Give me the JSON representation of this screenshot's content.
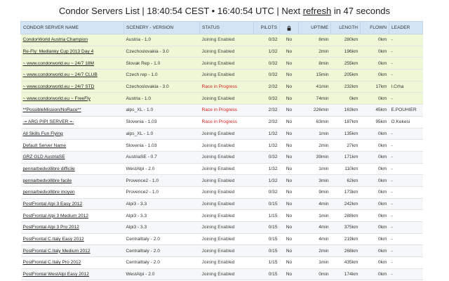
{
  "header": {
    "prefix": "Condor Servers List | 18:40:54 CEST • 16:40:54 UTC | Next ",
    "link": "refresh",
    "suffix": " in 47 seconds"
  },
  "columns": {
    "name": "CONDOR SERVER NAME",
    "scenery": "SCENERY - VERSION",
    "status": "STATUS",
    "pilots": "PILOTS",
    "lock": "lock-icon",
    "uptime": "UPTIME",
    "length": "LENGTH",
    "flown": "FLOWN",
    "leader": "LEADER"
  },
  "status_colors": {
    "ok": "#444444",
    "race": "#d8201f",
    "highlight_row": "#eef8d6",
    "header_bg": "#d3e5f5"
  },
  "rows": [
    {
      "name": "CondorWorld Austria Champion",
      "scenery": "Austria - 1.0",
      "status": "Joining Enabled",
      "pilots": "0/32",
      "lock": "No",
      "uptime": "8min",
      "length": "280km",
      "flown": "0km",
      "leader": "-",
      "style": "green",
      "race": false
    },
    {
      "name": "Re-Fly: Medlanky Cup 2013 Day 4",
      "scenery": "Czechoslovakia - 3.0",
      "status": "Joining Enabled",
      "pilots": "1/32",
      "lock": "No",
      "uptime": "2min",
      "length": "196km",
      "flown": "0km",
      "leader": "-",
      "style": "green",
      "race": false
    },
    {
      "name": "~ www.condorworld.eu ~ 24/7 18M",
      "scenery": "Slovak Rep - 1.0",
      "status": "Joining Enabled",
      "pilots": "0/32",
      "lock": "No",
      "uptime": "8min",
      "length": "255km",
      "flown": "0km",
      "leader": "-",
      "style": "green",
      "race": false
    },
    {
      "name": "~ www.condorworld.eu ~ 24/7 CLUB",
      "scenery": "Czech rep - 1.0",
      "status": "Joining Enabled",
      "pilots": "0/32",
      "lock": "No",
      "uptime": "15min",
      "length": "205km",
      "flown": "0km",
      "leader": "-",
      "style": "green",
      "race": false
    },
    {
      "name": "~ www.condorworld.eu ~ 24/7 STD",
      "scenery": "Czechoslovakia - 3.0",
      "status": "Race in Progress",
      "pilots": "2/32",
      "lock": "No",
      "uptime": "41min",
      "length": "232km",
      "flown": "17km",
      "leader": "I.Crha",
      "style": "green",
      "race": true
    },
    {
      "name": "~ www.condorworld.eu ~ FreeFly",
      "scenery": "Austria - 1.0",
      "status": "Joining Enabled",
      "pilots": "0/32",
      "lock": "No",
      "uptime": "74min",
      "length": "0km",
      "flown": "0km",
      "leader": "-",
      "style": "green",
      "race": false
    },
    {
      "name": "**PossibleMission/NoRace**",
      "scenery": "alps_XL - 1.0",
      "status": "Race in Progress",
      "pilots": "2/32",
      "lock": "No",
      "uptime": "226min",
      "length": "163km",
      "flown": "45km",
      "leader": "E.POUHIER",
      "style": "grey",
      "race": true
    },
    {
      "name": "-= ARG PIPI SERVER =-",
      "scenery": "Slovenia - 1.03",
      "status": "Race in Progress",
      "pilots": "2/32",
      "lock": "No",
      "uptime": "63min",
      "length": "187km",
      "flown": "95km",
      "leader": "O.Kekesi",
      "style": "white",
      "race": true
    },
    {
      "name": "All Skills Fun Flying",
      "scenery": "alps_XL - 1.0",
      "status": "Joining Enabled",
      "pilots": "1/32",
      "lock": "No",
      "uptime": "1min",
      "length": "135km",
      "flown": "0km",
      "leader": "-",
      "style": "grey",
      "race": false
    },
    {
      "name": "Default Server Name",
      "scenery": "Slovenia - 1.03",
      "status": "Joining Enabled",
      "pilots": "1/32",
      "lock": "No",
      "uptime": "2min",
      "length": "27km",
      "flown": "0km",
      "leader": "-",
      "style": "white",
      "race": false
    },
    {
      "name": "GRZ GLD AustriaSE",
      "scenery": "AustriaSE - 0.7",
      "status": "Joining Enabled",
      "pilots": "0/32",
      "lock": "No",
      "uptime": "39min",
      "length": "171km",
      "flown": "0km",
      "leader": "-",
      "style": "grey",
      "race": false
    },
    {
      "name": "pennarbedvollibre difficile",
      "scenery": "WestAlpi - 2.0",
      "status": "Joining Enabled",
      "pilots": "1/32",
      "lock": "No",
      "uptime": "1min",
      "length": "110km",
      "flown": "0km",
      "leader": "-",
      "style": "white",
      "race": false
    },
    {
      "name": "pennarbedvollibre facile",
      "scenery": "Provence2 - 1.0",
      "status": "Joining Enabled",
      "pilots": "1/32",
      "lock": "No",
      "uptime": "3min",
      "length": "62km",
      "flown": "0km",
      "leader": "-",
      "style": "grey",
      "race": false
    },
    {
      "name": "pennarbedvollibre moyen",
      "scenery": "Provence2 - 1.0",
      "status": "Joining Enabled",
      "pilots": "0/32",
      "lock": "No",
      "uptime": "9min",
      "length": "173km",
      "flown": "0km",
      "leader": "-",
      "style": "white",
      "race": false
    },
    {
      "name": "PostFrontal Alpi 3 Easy 2012",
      "scenery": "Alpi3 - 3.3",
      "status": "Joining Enabled",
      "pilots": "0/15",
      "lock": "No",
      "uptime": "4min",
      "length": "242km",
      "flown": "0km",
      "leader": "-",
      "style": "grey",
      "race": false
    },
    {
      "name": "PostFrontal Alpi 3 Medium 2012",
      "scenery": "Alpi3 - 3.3",
      "status": "Joining Enabled",
      "pilots": "1/15",
      "lock": "No",
      "uptime": "1min",
      "length": "288km",
      "flown": "0km",
      "leader": "-",
      "style": "white",
      "race": false
    },
    {
      "name": "PostFrontal Alpi 3 Pro 2012",
      "scenery": "Alpi3 - 3.3",
      "status": "Joining Enabled",
      "pilots": "0/15",
      "lock": "No",
      "uptime": "4min",
      "length": "375km",
      "flown": "0km",
      "leader": "-",
      "style": "grey",
      "race": false
    },
    {
      "name": "PostFrontal C.Italy Easy 2012",
      "scenery": "CentralItaly - 2.0",
      "status": "Joining Enabled",
      "pilots": "0/15",
      "lock": "No",
      "uptime": "4min",
      "length": "219km",
      "flown": "0km",
      "leader": "-",
      "style": "white",
      "race": false
    },
    {
      "name": "PostFrontal C.Italy Medium 2012",
      "scenery": "CentralItaly - 2.0",
      "status": "Joining Enabled",
      "pilots": "0/15",
      "lock": "No",
      "uptime": "2min",
      "length": "268km",
      "flown": "0km",
      "leader": "-",
      "style": "grey",
      "race": false
    },
    {
      "name": "PostFrontal C.Italy Pro 2012",
      "scenery": "CentralItaly - 2.0",
      "status": "Joining Enabled",
      "pilots": "1/15",
      "lock": "No",
      "uptime": "1min",
      "length": "435km",
      "flown": "0km",
      "leader": "-",
      "style": "white",
      "race": false
    },
    {
      "name": "PostFrontal WestAlpi Easy 2012",
      "scenery": "WestAlpi - 2.0",
      "status": "Joining Enabled",
      "pilots": "0/15",
      "lock": "No",
      "uptime": "0min",
      "length": "174km",
      "flown": "0km",
      "leader": "-",
      "style": "grey",
      "race": false
    }
  ]
}
